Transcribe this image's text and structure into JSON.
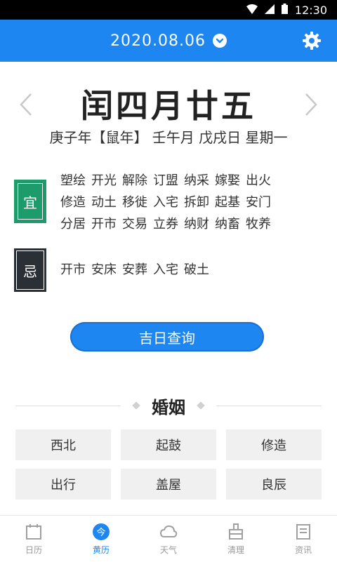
{
  "statusbar": {
    "time": "12:30"
  },
  "header": {
    "date": "2020.08.06"
  },
  "lunar": {
    "title": "闰四月廿五",
    "ganzhi": "庚子年【鼠年】 壬午月 戊戌日 星期一"
  },
  "yi": {
    "badge": "宜",
    "items": [
      [
        "塑绘",
        "开光",
        "解除",
        "订盟",
        "纳采",
        "嫁娶",
        "出火"
      ],
      [
        "修造",
        "动土",
        "移徙",
        "入宅",
        "拆卸",
        "起基",
        "安门"
      ],
      [
        "分居",
        "开市",
        "交易",
        "立券",
        "纳财",
        "纳畜",
        "牧养"
      ]
    ]
  },
  "ji": {
    "badge": "忌",
    "items": [
      [
        "开市",
        "安床",
        "安葬",
        "入宅",
        "破土"
      ]
    ]
  },
  "button": {
    "jiri": "吉日查询"
  },
  "section": {
    "title": "婚姻"
  },
  "grid": [
    "西北",
    "起鼓",
    "修造",
    "出行",
    "盖屋",
    "良辰"
  ],
  "tabs": [
    {
      "label": "日历",
      "icon": "calendar-icon",
      "active": false
    },
    {
      "label": "黄历",
      "icon": "almanac-icon",
      "active": true
    },
    {
      "label": "天气",
      "icon": "cloud-icon",
      "active": false
    },
    {
      "label": "清理",
      "icon": "clean-icon",
      "active": false
    },
    {
      "label": "资讯",
      "icon": "news-icon",
      "active": false
    }
  ],
  "colors": {
    "primary": "#1e86f0",
    "yi": "#1e9b6b",
    "ji": "#2b2f36"
  }
}
